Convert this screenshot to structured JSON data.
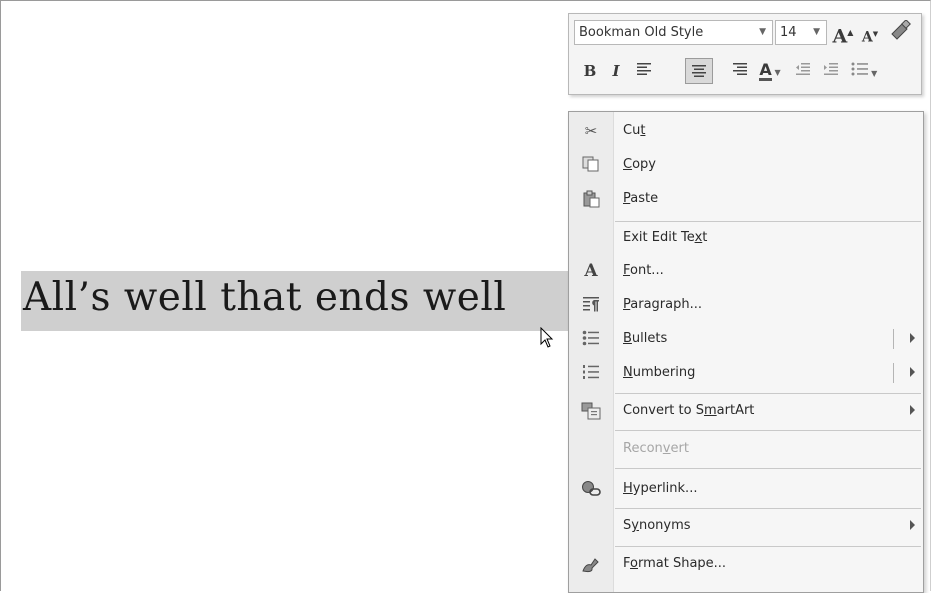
{
  "slide": {
    "text": "All’s well that ends well"
  },
  "mini_toolbar": {
    "font_name": "Bookman Old Style",
    "font_size": "14",
    "buttons": [
      {
        "name": "grow-font-button",
        "label": "A"
      },
      {
        "name": "shrink-font-button",
        "label": "A"
      },
      {
        "name": "format-painter-button",
        "icon": "paintbrush-icon"
      },
      {
        "name": "bold-button",
        "label": "B"
      },
      {
        "name": "italic-button",
        "label": "I"
      },
      {
        "name": "align-left-button",
        "icon": "align-left-icon"
      },
      {
        "name": "center-button",
        "icon": "align-center-icon",
        "active": true
      },
      {
        "name": "align-right-button",
        "icon": "align-right-icon"
      },
      {
        "name": "font-color-button",
        "label": "A"
      },
      {
        "name": "decrease-indent-button",
        "icon": "decrease-indent-icon"
      },
      {
        "name": "increase-indent-button",
        "icon": "increase-indent-icon"
      },
      {
        "name": "bullets-button",
        "icon": "bullets-icon"
      }
    ]
  },
  "context_menu": {
    "items": [
      {
        "label": "Cut",
        "mnemonic": "t",
        "icon": "scissors-icon"
      },
      {
        "label": "Copy",
        "mnemonic": "C",
        "icon": "copy-icon"
      },
      {
        "label": "Paste",
        "mnemonic": "P",
        "icon": "paste-icon"
      },
      {
        "label": "Exit Edit Text",
        "mnemonic": "x",
        "icon": ""
      },
      {
        "label": "Font...",
        "mnemonic": "F",
        "icon": "font-icon"
      },
      {
        "label": "Paragraph...",
        "mnemonic": "P",
        "icon": "paragraph-icon"
      },
      {
        "label": "Bullets",
        "mnemonic": "B",
        "icon": "bullets-icon",
        "submenu": true
      },
      {
        "label": "Numbering",
        "mnemonic": "N",
        "icon": "numbering-icon",
        "submenu": true
      },
      {
        "label": "Convert to SmartArt",
        "mnemonic": "m",
        "icon": "smartart-icon",
        "submenu": true
      },
      {
        "label": "Reconvert",
        "mnemonic": "v",
        "icon": "",
        "disabled": true
      },
      {
        "label": "Hyperlink...",
        "mnemonic": "H",
        "icon": "hyperlink-icon"
      },
      {
        "label": "Synonyms",
        "mnemonic": "y",
        "icon": "",
        "submenu": true
      },
      {
        "label": "Format Shape...",
        "mnemonic": "o",
        "icon": "format-shape-icon"
      }
    ]
  },
  "colors": {
    "selection": "#cfcfcf",
    "menu_background": "#f6f6f6",
    "disabled_text": "#a6a6a6"
  }
}
